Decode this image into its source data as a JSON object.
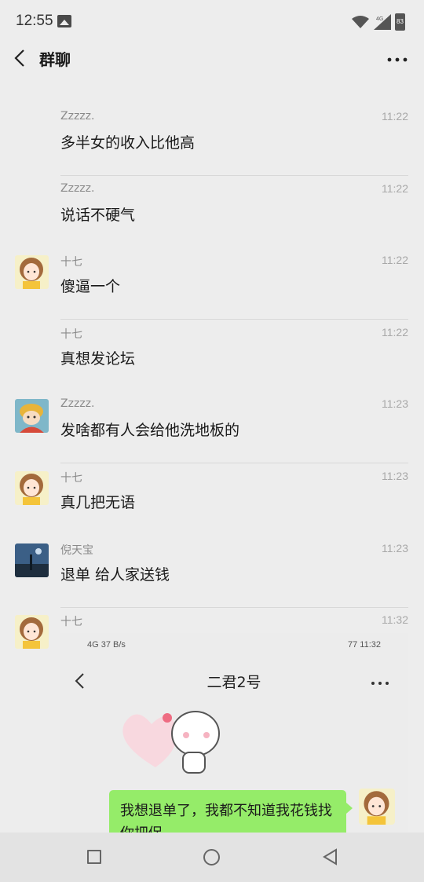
{
  "status_bar": {
    "time": "12:55",
    "network": "4G",
    "battery": "83"
  },
  "header": {
    "title": "群聊"
  },
  "messages": [
    {
      "sender": "Zzzzz.",
      "time": "11:22",
      "text": "多半女的收入比他高",
      "avatar": false,
      "divider": true
    },
    {
      "sender": "Zzzzz.",
      "time": "11:22",
      "text": "说话不硬气",
      "avatar": false,
      "divider": false
    },
    {
      "sender": "十七",
      "time": "11:22",
      "text": "傻逼一个",
      "avatar": true,
      "divider": true
    },
    {
      "sender": "十七",
      "time": "11:22",
      "text": "真想发论坛",
      "avatar": false,
      "divider": false
    },
    {
      "sender": "Zzzzz.",
      "time": "11:23",
      "text": "发啥都有人会给他洗地板的",
      "avatar": true,
      "divider": true
    },
    {
      "sender": "十七",
      "time": "11:23",
      "text": "真几把无语",
      "avatar": true,
      "divider": false
    },
    {
      "sender": "倪天宝",
      "time": "11:23",
      "text": "退单 给人家送钱",
      "avatar": true,
      "divider": true
    },
    {
      "sender": "十七",
      "time": "11:32",
      "text": "",
      "avatar": true,
      "divider": false
    }
  ],
  "screenshot": {
    "status_left": "4G 37 B/s",
    "status_right": "77 11:32",
    "title": "二君2号",
    "bubble_text": "我想退单了，我都不知道我花钱找你把促"
  },
  "icons": {
    "back": "back-icon",
    "more": "more-icon",
    "nav_square": "recent-apps-icon",
    "nav_circle": "home-icon",
    "nav_back": "system-back-icon"
  },
  "colors": {
    "background": "#ededed",
    "bubble": "#95ec69",
    "divider": "#d8d8d8"
  }
}
